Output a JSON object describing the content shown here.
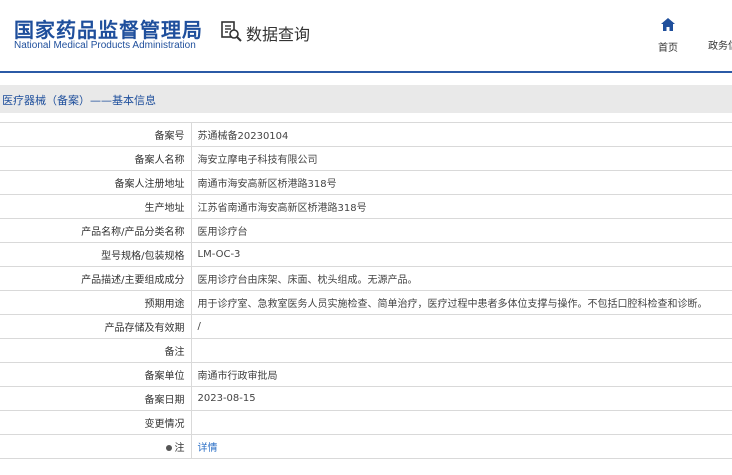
{
  "header": {
    "logo_cn": "国家药品监督管理局",
    "logo_en": "National Medical Products Administration",
    "query_label": "数据查询",
    "nav_home": "首页",
    "nav_gov": "政务信"
  },
  "section": {
    "title": "医疗器械（备案）——基本信息"
  },
  "rows": [
    {
      "label": "备案号",
      "value": "苏通械备20230104"
    },
    {
      "label": "备案人名称",
      "value": "海安立摩电子科技有限公司"
    },
    {
      "label": "备案人注册地址",
      "value": "南通市海安高新区桥港路318号"
    },
    {
      "label": "生产地址",
      "value": "江苏省南通市海安高新区桥港路318号"
    },
    {
      "label": "产品名称/产品分类名称",
      "value": "医用诊疗台"
    },
    {
      "label": "型号规格/包装规格",
      "value": "LM-OC-3"
    },
    {
      "label": "产品描述/主要组成成分",
      "value": "医用诊疗台由床架、床面、枕头组成。无源产品。"
    },
    {
      "label": "预期用途",
      "value": "用于诊疗室、急救室医务人员实施检查、简单治疗，医疗过程中患者多体位支撑与操作。不包括口腔科检查和诊断。"
    },
    {
      "label": "产品存储及有效期",
      "value": "/"
    },
    {
      "label": "备注",
      "value": ""
    },
    {
      "label": "备案单位",
      "value": "南通市行政审批局"
    },
    {
      "label": "备案日期",
      "value": "2023-08-15"
    },
    {
      "label": "变更情况",
      "value": ""
    },
    {
      "label": "注",
      "value": "详情"
    }
  ],
  "colors": {
    "brand": "#1f4f9c",
    "link": "#2b6fc6"
  }
}
